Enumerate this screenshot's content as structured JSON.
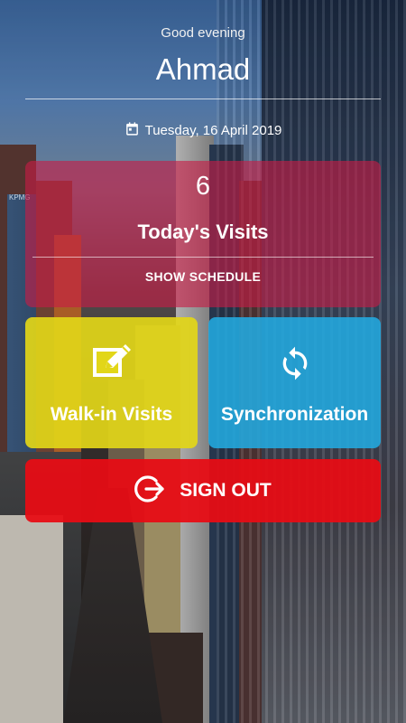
{
  "header": {
    "greeting": "Good evening",
    "username": "Ahmad",
    "date": "Tuesday, 16 April 2019",
    "date_icon": "calendar-icon"
  },
  "visits_card": {
    "count": "6",
    "label": "Today's Visits",
    "show_schedule_label": "SHOW SCHEDULE",
    "color": "#c81c46"
  },
  "tiles": [
    {
      "label": "Walk-in Visits",
      "icon": "edit-icon",
      "color": "#e2d618"
    },
    {
      "label": "Synchronization",
      "icon": "sync-icon",
      "color": "#22aae0"
    }
  ],
  "signout": {
    "label": "SIGN OUT",
    "icon": "logout-icon",
    "color": "#e80c14"
  },
  "background": {
    "sign_texts": [
      "KPMG"
    ]
  }
}
